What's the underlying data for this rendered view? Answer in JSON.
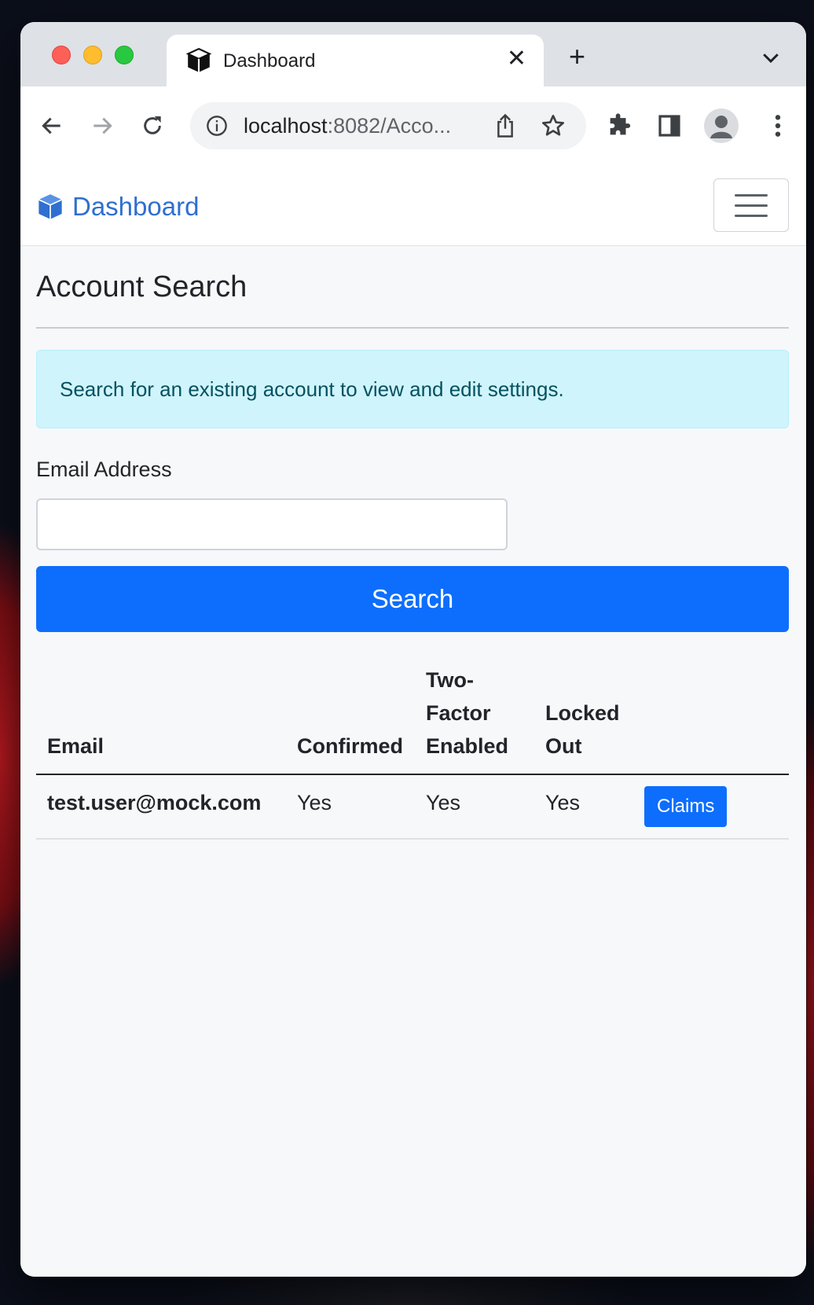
{
  "browser": {
    "tab_title": "Dashboard",
    "tab_close": "✕",
    "new_tab": "+",
    "url_host": "localhost",
    "url_rest": ":8082/Acco..."
  },
  "navbar": {
    "brand": "Dashboard"
  },
  "page": {
    "heading": "Account Search",
    "alert": "Search for an existing account to view and edit settings.",
    "email_label": "Email Address",
    "email_value": "",
    "search_button": "Search"
  },
  "table": {
    "headers": [
      "Email",
      "Confirmed",
      "Two-Factor Enabled",
      "Locked Out",
      ""
    ],
    "rows": [
      {
        "email": "test.user@mock.com",
        "confirmed": "Yes",
        "two_factor": "Yes",
        "locked_out": "Yes",
        "action": "Claims"
      }
    ]
  },
  "colors": {
    "primary": "#0d6efd",
    "brand": "#2f6fd0",
    "alert_bg": "#cff4fc",
    "alert_text": "#055160"
  },
  "icons": [
    "cube-icon",
    "back-arrow-icon",
    "forward-arrow-icon",
    "reload-icon",
    "info-icon",
    "share-icon",
    "star-icon",
    "extensions-icon",
    "side-panel-icon",
    "profile-icon",
    "menu-dots-icon",
    "chevron-down-icon",
    "hamburger-icon"
  ]
}
